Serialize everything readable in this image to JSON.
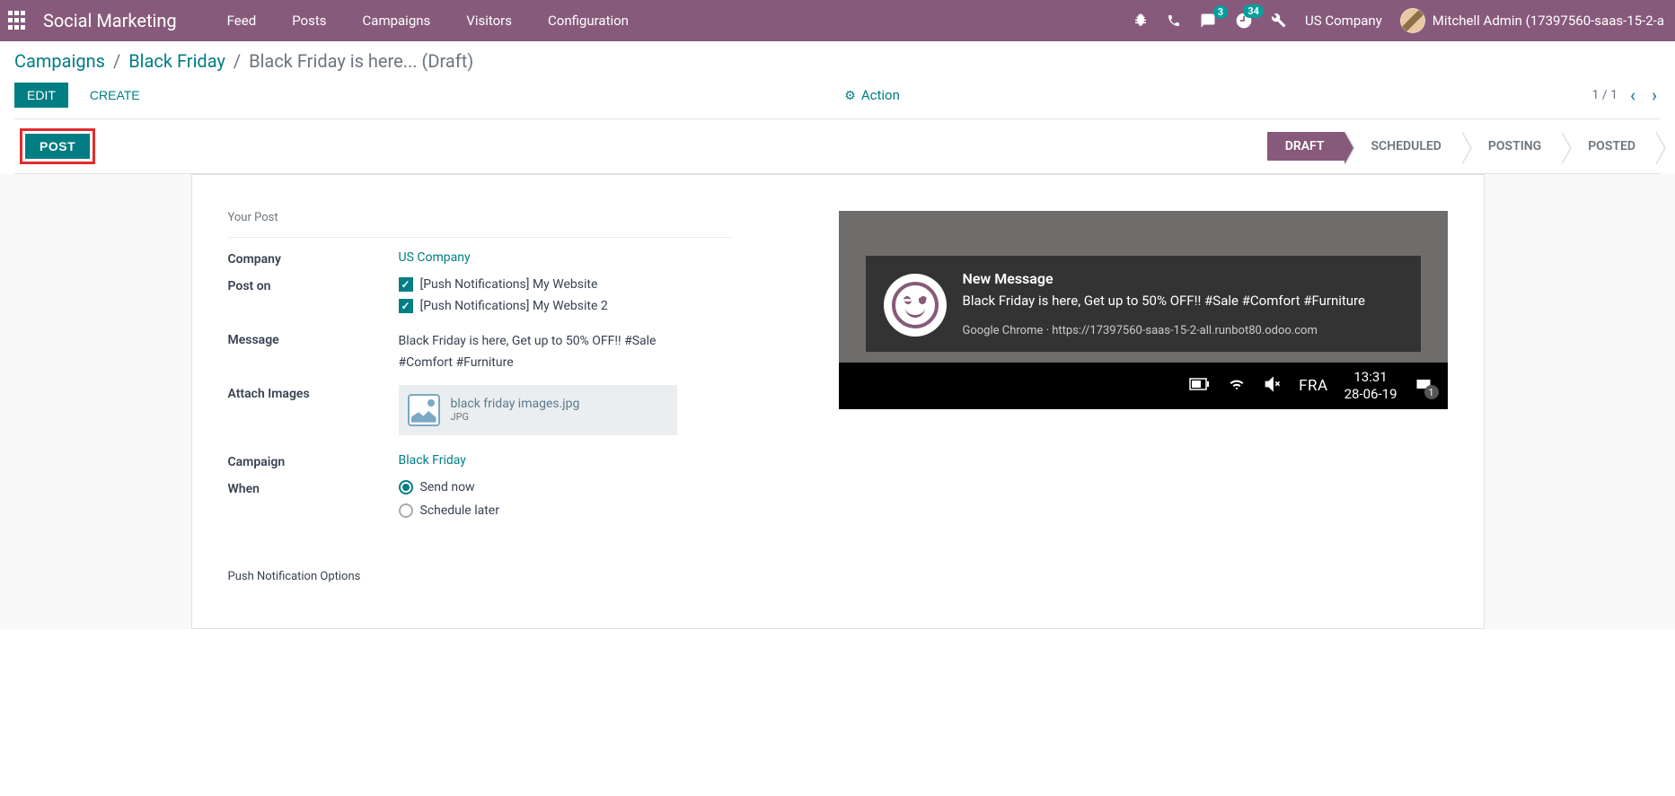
{
  "topnav": {
    "app_title": "Social Marketing",
    "menu": [
      "Feed",
      "Posts",
      "Campaigns",
      "Visitors",
      "Configuration"
    ],
    "badges": {
      "chat": "3",
      "activity": "34"
    },
    "company": "US Company",
    "user": "Mitchell Admin (17397560-saas-15-2-a"
  },
  "breadcrumb": {
    "item1": "Campaigns",
    "item2": "Black Friday",
    "item3": "Black Friday is here... (Draft)"
  },
  "cp": {
    "edit": "EDIT",
    "create": "CREATE",
    "action": "Action",
    "pager": "1 / 1"
  },
  "statusbar": {
    "post": "POST",
    "steps": [
      "DRAFT",
      "SCHEDULED",
      "POSTING",
      "POSTED"
    ]
  },
  "form": {
    "section_title": "Your Post",
    "labels": {
      "company": "Company",
      "post_on": "Post on",
      "message": "Message",
      "attach": "Attach Images",
      "campaign": "Campaign",
      "when": "When"
    },
    "company_value": "US Company",
    "post_on": [
      "[Push Notifications] My Website",
      "[Push Notifications] My Website 2"
    ],
    "message_value": "Black Friday is here, Get up to 50% OFF!! #Sale #Comfort #Furniture",
    "attachment": {
      "name": "black friday images.jpg",
      "type": "JPG"
    },
    "campaign_value": "Black Friday",
    "when_options": [
      "Send now",
      "Schedule later"
    ],
    "push_section": "Push Notification Options"
  },
  "preview": {
    "title": "New Message",
    "body": "Black Friday is here, Get up to 50% OFF!! #Sale #Comfort #Furniture",
    "footer_app": "Google Chrome",
    "footer_sep": " · ",
    "footer_url": "https://17397560-saas-15-2-all.runbot80.odoo.com",
    "taskbar": {
      "lang": "FRA",
      "time": "13:31",
      "date": "28-06-19",
      "notif_count": "1"
    }
  }
}
